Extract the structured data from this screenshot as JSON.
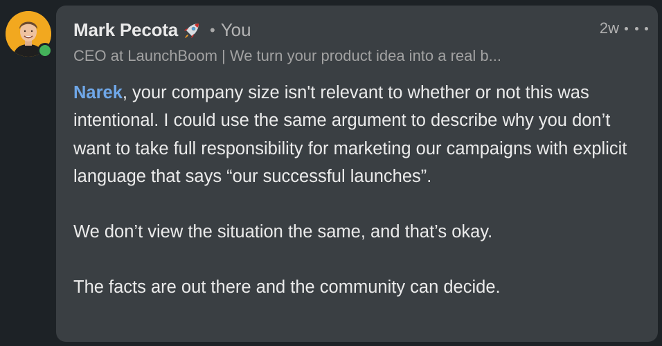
{
  "comment": {
    "author": {
      "name": "Mark Pecota",
      "emoji_icon": "rocket-icon",
      "relationship": "You",
      "headline": "CEO at LaunchBoom | We turn your product idea into a real b...",
      "online": true,
      "avatar_bg": "#f2a81f"
    },
    "timestamp": "2w",
    "more_icon": "ellipsis-icon",
    "mention": "Narek",
    "paragraphs": [
      ", your company size isn't relevant to whether or not this was intentional. I could use the same argument to describe why you don’t want to take full responsibility for marketing our campaigns with explicit language that says “our successful launches”.",
      "We don’t view the situation the same, and that’s okay.",
      "The facts are out there and the community can decide."
    ]
  },
  "colors": {
    "background": "#1d2226",
    "card": "#3a3f43",
    "mention": "#6fa7e8",
    "presence": "#44b35a"
  }
}
